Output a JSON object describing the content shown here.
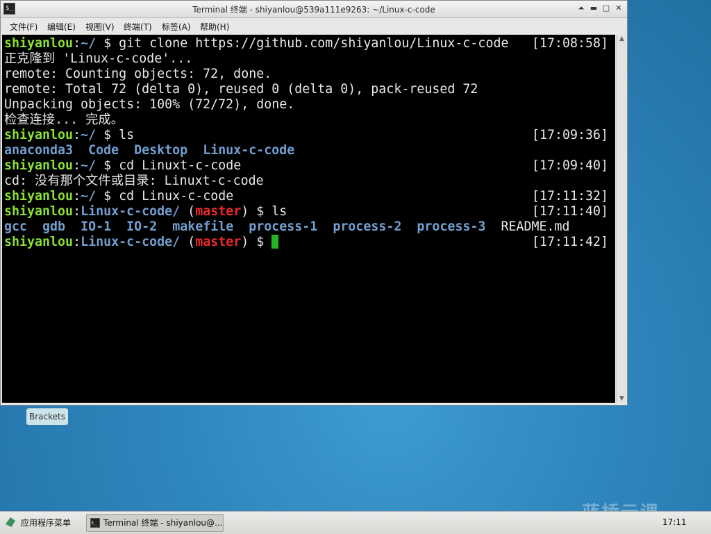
{
  "window": {
    "title": "Terminal 终端 - shiyanlou@539a111e9263: ~/Linux-c-code",
    "controls": [
      "⏶",
      "▬",
      "□",
      "✕"
    ]
  },
  "menubar": {
    "items": [
      "文件(F)",
      "编辑(E)",
      "视图(V)",
      "终端(T)",
      "标签(A)",
      "帮助(H)"
    ]
  },
  "terminal": {
    "user": "shiyanlou",
    "home_path": "~/",
    "repo_path": "Linux-c-code/",
    "branch": "master",
    "prompt_symbol": "$",
    "lines": {
      "l1_cmd": "git clone https://github.com/shiyanlou/Linux-c-code",
      "l1_ts": "[17:08:58]",
      "l2": "正克隆到 'Linux-c-code'...",
      "l3": "remote: Counting objects: 72, done.",
      "l4": "remote: Total 72 (delta 0), reused 0 (delta 0), pack-reused 72",
      "l5": "Unpacking objects: 100% (72/72), done.",
      "l6": "检查连接... 完成。",
      "l7_cmd": "ls",
      "l7_ts": "[17:09:36]",
      "l8_dirs": [
        "anaconda3",
        "Code",
        "Desktop",
        "Linux-c-code"
      ],
      "l9_cmd": "cd Linuxt-c-code",
      "l9_ts": "[17:09:40]",
      "l10": "cd: 没有那个文件或目录: Linuxt-c-code",
      "l11_cmd": "cd Linux-c-code",
      "l11_ts": "[17:11:32]",
      "l12_cmd": "ls",
      "l12_ts": "[17:11:40]",
      "l13_dirs": [
        "gcc",
        "gdb",
        "IO-1",
        "IO-2",
        "makefile",
        "process-1",
        "process-2",
        "process-3"
      ],
      "l13_file": "README.md",
      "l14_ts": "[17:11:42]"
    }
  },
  "desktop": {
    "icon_label": "Brackets",
    "watermark": "蓝桥云课"
  },
  "taskbar": {
    "app_menu_label": "应用程序菜单",
    "task_label": "Terminal 终端 - shiyanlou@…",
    "clock": "17:11"
  }
}
